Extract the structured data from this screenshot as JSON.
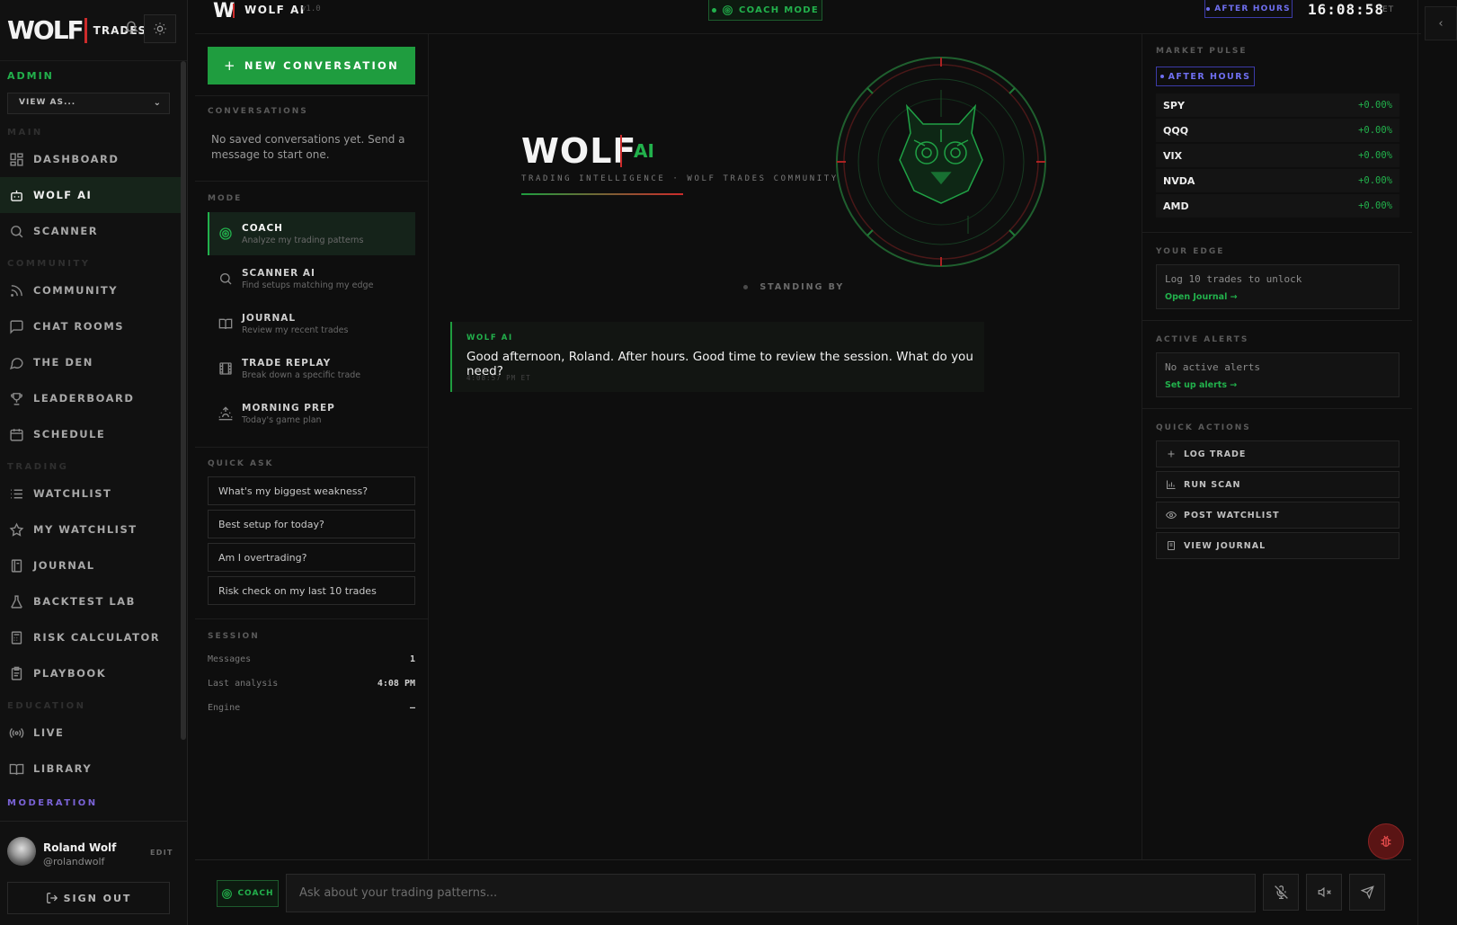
{
  "brand": {
    "logo": "WOLF",
    "name": "TRADES"
  },
  "admin": {
    "label": "ADMIN",
    "view_as": "VIEW AS..."
  },
  "nav": {
    "sections": {
      "main": "MAIN",
      "community": "COMMUNITY",
      "trading": "TRADING",
      "education": "EDUCATION",
      "moderation": "MODERATION"
    },
    "items": [
      {
        "label": "DASHBOARD",
        "icon": "grid-icon"
      },
      {
        "label": "WOLF AI",
        "icon": "robot-icon",
        "active": true
      },
      {
        "label": "SCANNER",
        "icon": "search-icon"
      },
      {
        "label": "COMMUNITY",
        "icon": "rss-icon"
      },
      {
        "label": "CHAT ROOMS",
        "icon": "chat-icon"
      },
      {
        "label": "THE DEN",
        "icon": "message-circle-icon"
      },
      {
        "label": "LEADERBOARD",
        "icon": "trophy-icon"
      },
      {
        "label": "SCHEDULE",
        "icon": "calendar-icon"
      },
      {
        "label": "WATCHLIST",
        "icon": "list-icon"
      },
      {
        "label": "MY WATCHLIST",
        "icon": "star-icon"
      },
      {
        "label": "JOURNAL",
        "icon": "notebook-icon"
      },
      {
        "label": "BACKTEST LAB",
        "icon": "flask-icon"
      },
      {
        "label": "RISK CALCULATOR",
        "icon": "calculator-icon"
      },
      {
        "label": "PLAYBOOK",
        "icon": "clipboard-icon"
      },
      {
        "label": "LIVE",
        "icon": "broadcast-icon"
      },
      {
        "label": "LIBRARY",
        "icon": "book-icon"
      }
    ]
  },
  "user": {
    "name": "Roland Wolf",
    "handle": "@rolandwolf",
    "edit": "EDIT",
    "sign_out": "SIGN OUT"
  },
  "topbar": {
    "logo": "W",
    "title": "WOLF AI",
    "version": "v1.0",
    "mode": "COACH MODE",
    "market_status": "AFTER HOURS",
    "clock": "16:08:58",
    "tz": "ET"
  },
  "conversations": {
    "new_button": "NEW CONVERSATION",
    "label": "CONVERSATIONS",
    "empty": "No saved conversations yet. Send a message to start one."
  },
  "modes": {
    "label": "MODE",
    "items": [
      {
        "title": "COACH",
        "desc": "Analyze my trading patterns",
        "icon": "target-icon",
        "active": true
      },
      {
        "title": "SCANNER AI",
        "desc": "Find setups matching my edge",
        "icon": "search-icon"
      },
      {
        "title": "JOURNAL",
        "desc": "Review my recent trades",
        "icon": "book-open-icon"
      },
      {
        "title": "TRADE REPLAY",
        "desc": "Break down a specific trade",
        "icon": "film-icon"
      },
      {
        "title": "MORNING PREP",
        "desc": "Today's game plan",
        "icon": "sunrise-icon"
      }
    ]
  },
  "quick_ask": {
    "label": "QUICK ASK",
    "items": [
      "What's my biggest weakness?",
      "Best setup for today?",
      "Am I overtrading?",
      "Risk check on my last 10 trades"
    ]
  },
  "session": {
    "label": "SESSION",
    "rows": [
      {
        "k": "Messages",
        "v": "1"
      },
      {
        "k": "Last analysis",
        "v": "4:08 PM"
      },
      {
        "k": "Engine",
        "v": "—"
      }
    ]
  },
  "hero": {
    "title": "WOLF",
    "ai": "AI",
    "subtitle": "TRADING INTELLIGENCE · WOLF TRADES COMMUNITY",
    "status": "STANDING BY"
  },
  "message": {
    "from": "WOLF AI",
    "text": "Good afternoon, Roland. After hours. Good time to review the session. What do you need?",
    "time": "4:08:57 PM ET"
  },
  "market_pulse": {
    "label": "MARKET PULSE",
    "status": "AFTER HOURS",
    "tickers": [
      {
        "symbol": "SPY",
        "change": "+0.00%"
      },
      {
        "symbol": "QQQ",
        "change": "+0.00%"
      },
      {
        "symbol": "VIX",
        "change": "+0.00%"
      },
      {
        "symbol": "NVDA",
        "change": "+0.00%"
      },
      {
        "symbol": "AMD",
        "change": "+0.00%"
      }
    ]
  },
  "your_edge": {
    "label": "YOUR EDGE",
    "text": "Log 10 trades to unlock",
    "link": "Open Journal →"
  },
  "alerts": {
    "label": "ACTIVE ALERTS",
    "text": "No active alerts",
    "link": "Set up alerts →"
  },
  "quick_actions": {
    "label": "QUICK ACTIONS",
    "items": [
      {
        "label": "LOG TRADE",
        "icon": "plus-icon"
      },
      {
        "label": "RUN SCAN",
        "icon": "bar-chart-icon"
      },
      {
        "label": "POST WATCHLIST",
        "icon": "eye-icon"
      },
      {
        "label": "VIEW JOURNAL",
        "icon": "journal-icon"
      }
    ]
  },
  "input": {
    "mode_chip": "COACH",
    "placeholder": "Ask about your trading patterns..."
  },
  "colors": {
    "accent": "#22b14c",
    "danger": "#cc2b2b",
    "after_hours": "#6f6ff0",
    "background": "#0e0e0e"
  }
}
